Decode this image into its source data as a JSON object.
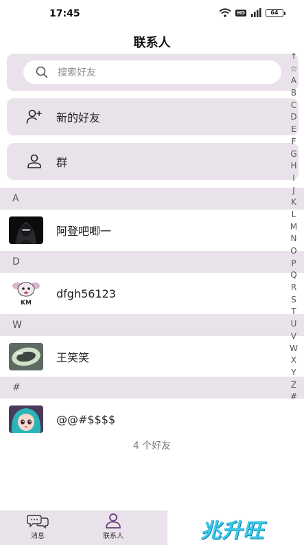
{
  "status_bar": {
    "time": "17:45",
    "hd": "HD",
    "battery": "64"
  },
  "header": {
    "title": "联系人"
  },
  "search": {
    "placeholder": "搜索好友"
  },
  "actions": {
    "new_friends": "新的好友",
    "groups": "群"
  },
  "sections": [
    {
      "letter": "A",
      "contact": {
        "name": "阿登吧唧一",
        "avatar": "dark-hooded-figure-avatar"
      }
    },
    {
      "letter": "D",
      "contact": {
        "name": "dfgh56123",
        "avatar": "km-cartoon-avatar"
      }
    },
    {
      "letter": "W",
      "contact": {
        "name": "王笑笑",
        "avatar": "jade-bangle-avatar"
      }
    },
    {
      "letter": "#",
      "contact": {
        "name": "@@#$$$$",
        "avatar": "anime-girl-avatar"
      }
    }
  ],
  "friend_count": "4 个好友",
  "alpha_index": [
    "↑",
    "☆",
    "A",
    "B",
    "C",
    "D",
    "E",
    "F",
    "G",
    "H",
    "I",
    "J",
    "K",
    "L",
    "M",
    "N",
    "O",
    "P",
    "Q",
    "R",
    "S",
    "T",
    "U",
    "V",
    "W",
    "X",
    "Y",
    "Z",
    "#"
  ],
  "tabs": {
    "messages": "消息",
    "contacts": "联系人"
  },
  "brand": {
    "text": "兆升旺"
  },
  "colors": {
    "accent_bg": "#eae2ea",
    "brand": "#38c8e8"
  }
}
